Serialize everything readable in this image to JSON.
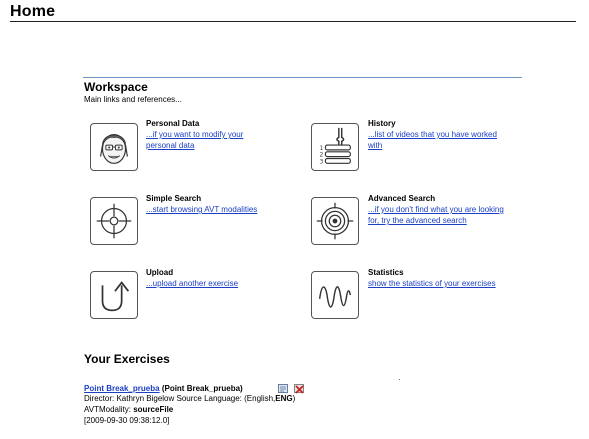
{
  "page": {
    "title": "Home"
  },
  "workspace": {
    "title": "Workspace",
    "subtitle": "Main links and references..."
  },
  "tiles": {
    "personal": {
      "title": "Personal Data",
      "link1": "...if you want to modify your",
      "link2": "personal data",
      "icon": "person-face-icon"
    },
    "history": {
      "title": "History",
      "link1": "...list of videos that you have worked",
      "link2": "with",
      "icon": "history-list-icon"
    },
    "simple_search": {
      "title": "Simple Search",
      "link1": "...start browsing AVT modalities",
      "icon": "crosshair-icon"
    },
    "advanced_search": {
      "title": "Advanced Search",
      "link1": "...if you don't find what you are looking",
      "link2": "for, try the advanced search",
      "icon": "target-icon"
    },
    "upload": {
      "title": "Upload",
      "link1": "...upload another exercise",
      "icon": "upload-arrow-icon"
    },
    "statistics": {
      "title": "Statistics",
      "link1": "show the statistics of your exercises",
      "icon": "waveform-icon"
    }
  },
  "exercises": {
    "heading": "Your Exercises",
    "items": [
      {
        "title_link": "Point Break_prueba",
        "title_paren": "(Point Break_prueba)",
        "director_label": "Director:",
        "director": "Kathryn Bigelow",
        "source_label": "Source Language:",
        "source_lang_prefix": "(English,",
        "source_lang_code": "ENG",
        "source_lang_suffix": ")",
        "modality_label": "AVTModality:",
        "modality": "sourceFile",
        "date": "[2009-09-30 09:38:12.0]"
      }
    ]
  },
  "colors": {
    "link": "#1a3ec4",
    "rule": "#6f93c2",
    "delete": "#cc2222"
  }
}
